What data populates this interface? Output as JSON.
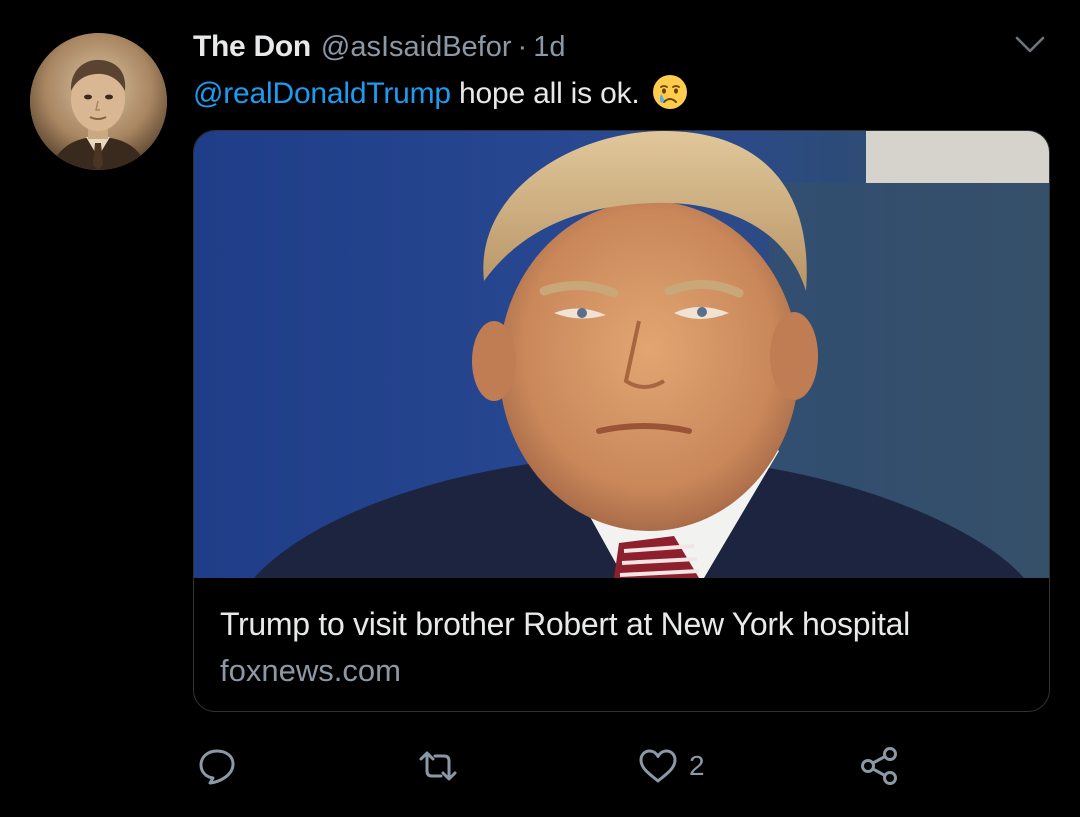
{
  "tweet": {
    "display_name": "The Don",
    "handle": "@asIsaidBefor",
    "separator": "·",
    "time": "1d",
    "mention": "@realDonaldTrump",
    "text": " hope all is ok.",
    "emoji": "crying-face-emoji",
    "avatar": "vintage-portrait-avatar"
  },
  "card": {
    "title": "Trump to visit brother Robert at New York hospital",
    "domain": "foxnews.com",
    "image": "portrait-photo"
  },
  "actions": {
    "reply_icon": "reply-icon",
    "retweet_icon": "retweet-icon",
    "like_icon": "heart-icon",
    "like_count": "2",
    "share_icon": "share-icon"
  },
  "colors": {
    "background": "#000000",
    "text_primary": "#e7e9ea",
    "text_secondary": "#8b98a5",
    "link": "#1d9bf0",
    "border": "#2f3336"
  }
}
